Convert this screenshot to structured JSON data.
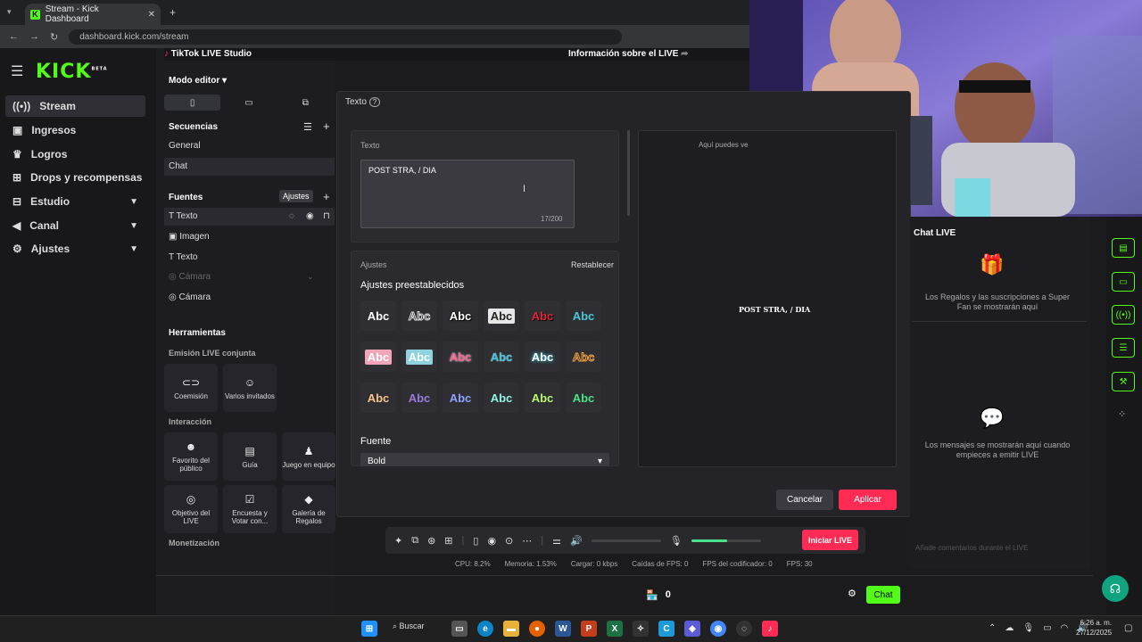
{
  "browser": {
    "tab_title": "Stream - Kick Dashboard",
    "url": "dashboard.kick.com/stream"
  },
  "kick": {
    "logo": "KICK",
    "logo_badge": "BETA",
    "menu": [
      {
        "label": "Stream",
        "icon": "radio-icon"
      },
      {
        "label": "Ingresos",
        "icon": "money-icon"
      },
      {
        "label": "Logros",
        "icon": "trophy-icon"
      },
      {
        "label": "Drops y recompensas",
        "icon": "gift-icon"
      },
      {
        "label": "Estudio",
        "icon": "studio-icon"
      },
      {
        "label": "Canal",
        "icon": "megaphone-icon"
      },
      {
        "label": "Ajustes",
        "icon": "gear-icon"
      }
    ],
    "viewer_count": "0",
    "chat_button": "Chat"
  },
  "studio": {
    "app_title": "TikTok LIVE Studio",
    "info_link": "Información sobre el LIVE",
    "mode": "Modo editor",
    "sequences_header": "Secuencias",
    "sequences": [
      "General",
      "Chat"
    ],
    "sources_header": "Fuentes",
    "sources_tooltip": "Ajustes",
    "sources": [
      "Texto",
      "Imagen",
      "Texto",
      "Cámara",
      "Cámara"
    ],
    "tools_header": "Herramientas",
    "joint_header": "Emisión LIVE conjunta",
    "joint_tools": [
      "Coemisión",
      "Varios invitados"
    ],
    "interaction_header": "Interacción",
    "interaction_tools": [
      "Favorito del público",
      "Guía",
      "Juego en equipo",
      "Objetivo del LIVE",
      "Encuesta y Votar con...",
      "Galería de Regalos"
    ],
    "monetization_header": "Monetización"
  },
  "dialog": {
    "title": "Texto",
    "text_label": "Texto",
    "text_value": "POST STRA, / DIA",
    "counter": "17/200",
    "settings_label": "Ajustes",
    "reset": "Restablecer",
    "presets_header": "Ajustes preestablecidos",
    "preset_label": "Abc",
    "font_label": "Fuente",
    "font_value": "Bold",
    "preview_hint": "Aquí puedes ve",
    "preview_text": "POST STRA, / DIA",
    "cancel": "Cancelar",
    "apply": "Aplicar"
  },
  "chat": {
    "title": "Chat LIVE",
    "gifts_note": "Los Regalos y las suscripciones a Super Fan se mostrarán aquí",
    "messages_note": "Los mensajes se mostrarán aquí cuando empieces a emitir LIVE",
    "input_placeholder": "Añade comentarios durante el LIVE"
  },
  "toolbar": {
    "go_live": "Iniciar LIVE"
  },
  "stats": {
    "cpu": "CPU: 8.2%",
    "memory": "Memoria: 1.53%",
    "load": "Cargar: 0 kbps",
    "fps_drops": "Caídas de FPS: 0",
    "encoder_fps": "FPS del codificador: 0",
    "fps": "FPS: 30"
  },
  "taskbar": {
    "search": "Buscar",
    "time": "6:26 a. m.",
    "date": "27/12/2025"
  },
  "colors": {
    "kick_green": "#53fc18",
    "tiktok_pink": "#fe2c55"
  }
}
